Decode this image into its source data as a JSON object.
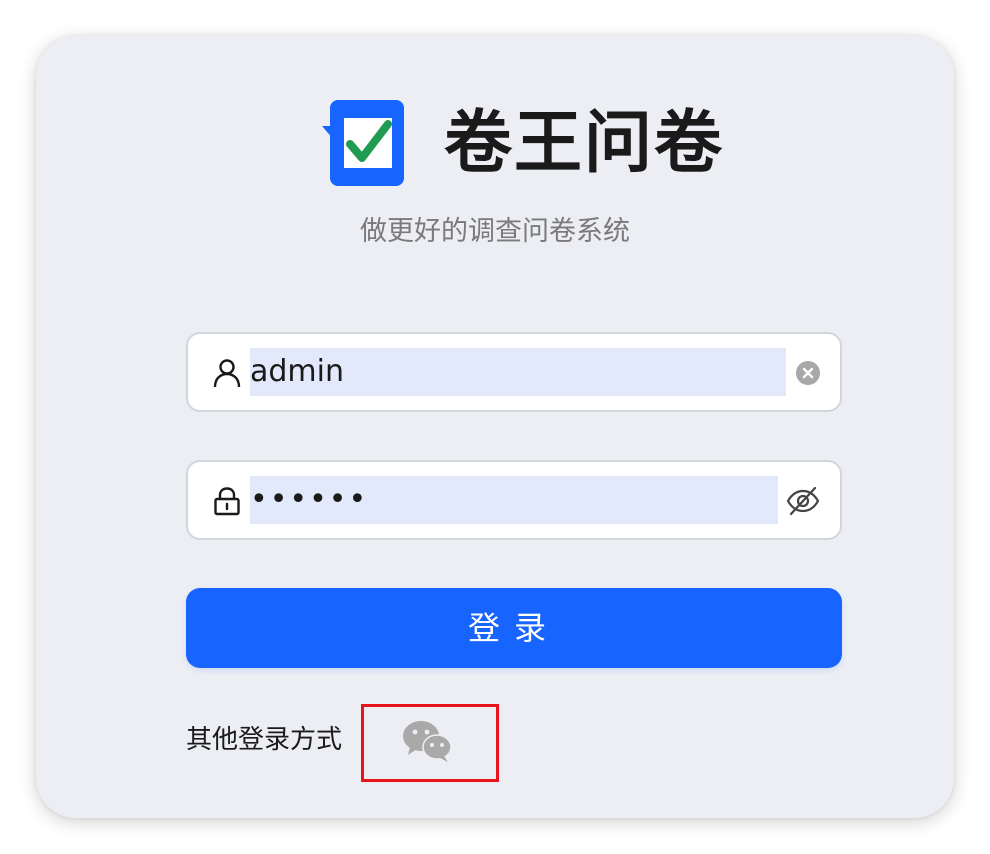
{
  "header": {
    "app_title": "卷王问卷",
    "subtitle": "做更好的调查问卷系统",
    "logo_icon": "checklist-logo-icon"
  },
  "form": {
    "username": {
      "value": "admin",
      "icon": "user-icon",
      "clear_icon": "clear-icon"
    },
    "password": {
      "value": "••••••",
      "icon": "lock-icon",
      "toggle_icon": "eye-off-icon"
    },
    "login_label": "登录"
  },
  "alt_login": {
    "label": "其他登录方式",
    "icon": "wechat-icon"
  },
  "colors": {
    "primary": "#1764ff",
    "card_bg": "#eceef3",
    "highlight": "#e8141b",
    "logo_check": "#1f9b52"
  }
}
